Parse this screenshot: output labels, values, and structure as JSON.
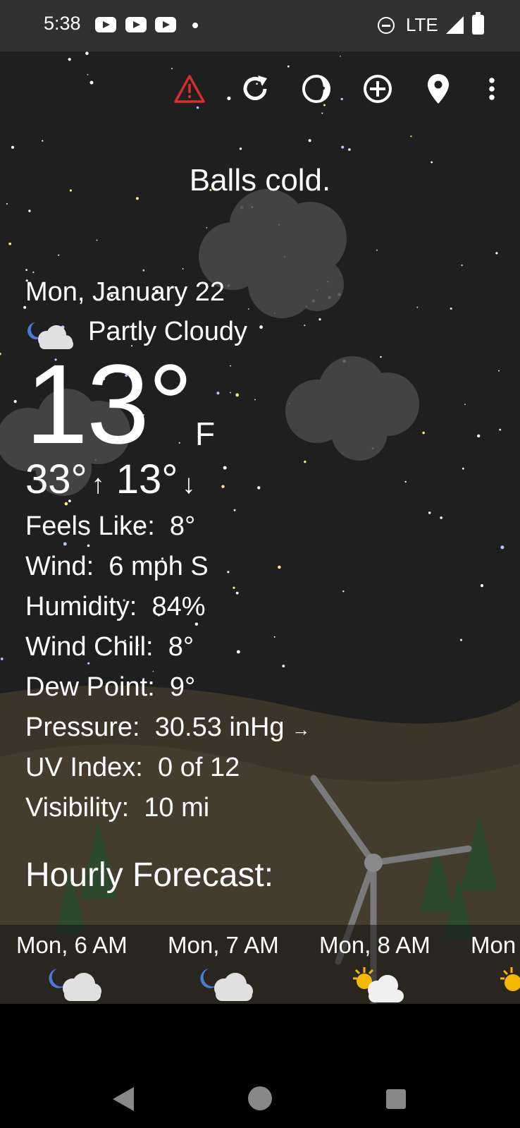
{
  "status_bar": {
    "time": "5:38",
    "network": "LTE",
    "notification_icons": [
      "youtube-icon",
      "youtube-icon",
      "youtube-icon"
    ]
  },
  "toolbar": {
    "icons": [
      "alert-triangle-icon",
      "refresh-icon",
      "moon-phase-icon",
      "add-location-icon",
      "location-pin-icon",
      "more-vert-icon"
    ],
    "alert_color": "#d32f2f"
  },
  "tagline": "Balls cold.",
  "current": {
    "date": "Mon, January 22",
    "condition": "Partly Cloudy",
    "condition_icon": "partly-cloudy-night-icon",
    "temperature": "13°",
    "unit": "F",
    "high": "33°",
    "high_arrow": "↑",
    "low": "13°",
    "low_arrow": "↓"
  },
  "details": [
    {
      "label": "Feels Like:",
      "value": "8°"
    },
    {
      "label": "Wind:",
      "value": "6 mph S"
    },
    {
      "label": "Humidity:",
      "value": "84%"
    },
    {
      "label": "Wind Chill:",
      "value": "8°"
    },
    {
      "label": "Dew Point:",
      "value": "9°"
    },
    {
      "label": "Pressure:",
      "value": "30.53 inHg",
      "trend": "→"
    },
    {
      "label": "UV Index:",
      "value": "0 of 12"
    },
    {
      "label": "Visibility:",
      "value": "10 mi"
    }
  ],
  "hourly": {
    "title": "Hourly Forecast:",
    "items": [
      {
        "label": "Mon, 6 AM",
        "icon": "partly-cloudy-night-icon"
      },
      {
        "label": "Mon, 7 AM",
        "icon": "partly-cloudy-night-icon"
      },
      {
        "label": "Mon, 8 AM",
        "icon": "partly-cloudy-day-icon"
      },
      {
        "label": "Mon",
        "icon": "sun-icon"
      }
    ]
  },
  "nav_bar": {
    "buttons": [
      "back-icon",
      "home-icon",
      "recents-icon"
    ]
  }
}
